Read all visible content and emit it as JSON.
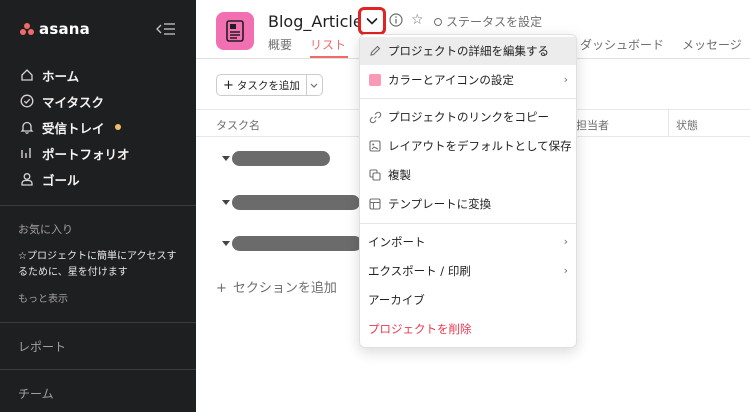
{
  "sidebar": {
    "logo_text": "asana",
    "nav": [
      {
        "label": "ホーム",
        "icon": "home-icon"
      },
      {
        "label": "マイタスク",
        "icon": "check-circle-icon"
      },
      {
        "label": "受信トレイ",
        "icon": "bell-icon"
      },
      {
        "label": "ポートフォリオ",
        "icon": "bar-chart-icon"
      },
      {
        "label": "ゴール",
        "icon": "person-icon"
      }
    ],
    "favorites_title": "お気に入り",
    "favorites_hint": "☆プロジェクトに簡単にアクセスするために、星を付けます",
    "show_more": "もっと表示",
    "reports_label": "レポート",
    "teams_label": "チーム"
  },
  "project": {
    "title": "Blog_Article",
    "status_label": "ステータスを設定",
    "tabs": [
      "概要",
      "リスト",
      "ダッシュボード",
      "メッセージ"
    ],
    "active_tab": "リスト"
  },
  "toolbar": {
    "add_task_label": "タスクを追加"
  },
  "table": {
    "columns": [
      "タスク名",
      "担当者",
      "状態"
    ]
  },
  "add_section_label": "セクションを追加",
  "dropdown": {
    "items": [
      {
        "label": "プロジェクトの詳細を編集する",
        "icon": "pencil-icon",
        "highlighted": true
      },
      {
        "label": "カラーとアイコンの設定",
        "icon": "color-swatch-icon",
        "submenu": true
      },
      {
        "label": "プロジェクトのリンクをコピー",
        "icon": "link-icon"
      },
      {
        "label": "レイアウトをデフォルトとして保存",
        "icon": "layout-icon"
      },
      {
        "label": "複製",
        "icon": "duplicate-icon"
      },
      {
        "label": "テンプレートに変換",
        "icon": "template-icon"
      },
      {
        "label": "インポート",
        "submenu": true
      },
      {
        "label": "エクスポート / 印刷",
        "submenu": true
      },
      {
        "label": "アーカイブ"
      },
      {
        "label": "プロジェクトを削除",
        "danger": true
      }
    ]
  },
  "colors": {
    "sidebar_bg": "#1e1f21",
    "accent": "#f06a6a",
    "project_icon": "#f26fb2",
    "highlight_box": "#e02424",
    "danger": "#e8384f",
    "notification_dot": "#f1bd6c"
  }
}
